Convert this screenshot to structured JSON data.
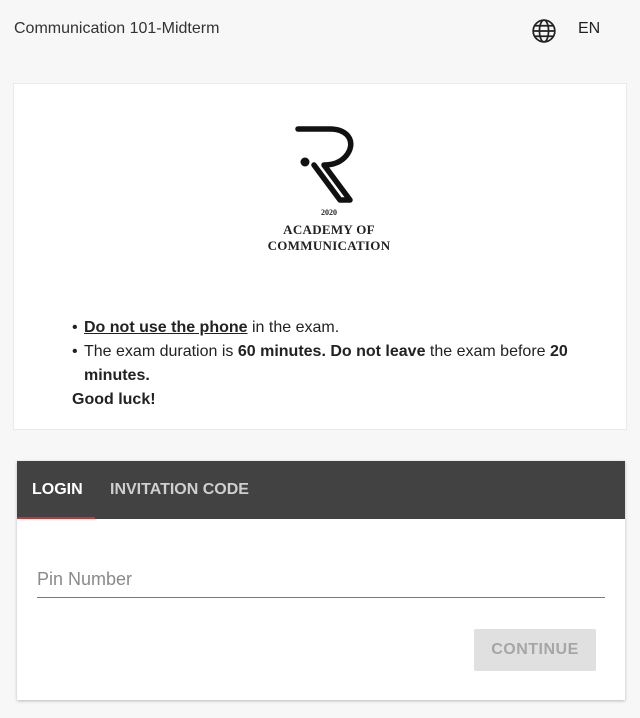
{
  "header": {
    "title": "Communication 101-Midterm",
    "language_icon": "globe-icon",
    "language": "EN"
  },
  "logo": {
    "year": "2020",
    "line1": "ACADEMY OF",
    "line2": "COMMUNICATION"
  },
  "rules": {
    "bullet": "•",
    "rule1_emphasis": "Do not use the phone",
    "rule1_rest": " in the exam.",
    "rule2_a": "The exam duration is ",
    "rule2_b": "60 minutes.",
    "rule2_c": " Do not leave",
    "rule2_d": " the exam before ",
    "rule2_e": "20 minutes.",
    "closing": "Good luck!"
  },
  "login": {
    "tabs": [
      {
        "label": "LOGIN",
        "active": true
      },
      {
        "label": "INVITATION CODE",
        "active": false
      }
    ],
    "pin_placeholder": "Pin Number",
    "pin_value": "",
    "continue_label": "CONTINUE",
    "continue_disabled": true
  },
  "colors": {
    "tab_bar": "#424242",
    "tab_indicator": "#d32f2f",
    "button_disabled_bg": "#e0e0e0"
  }
}
